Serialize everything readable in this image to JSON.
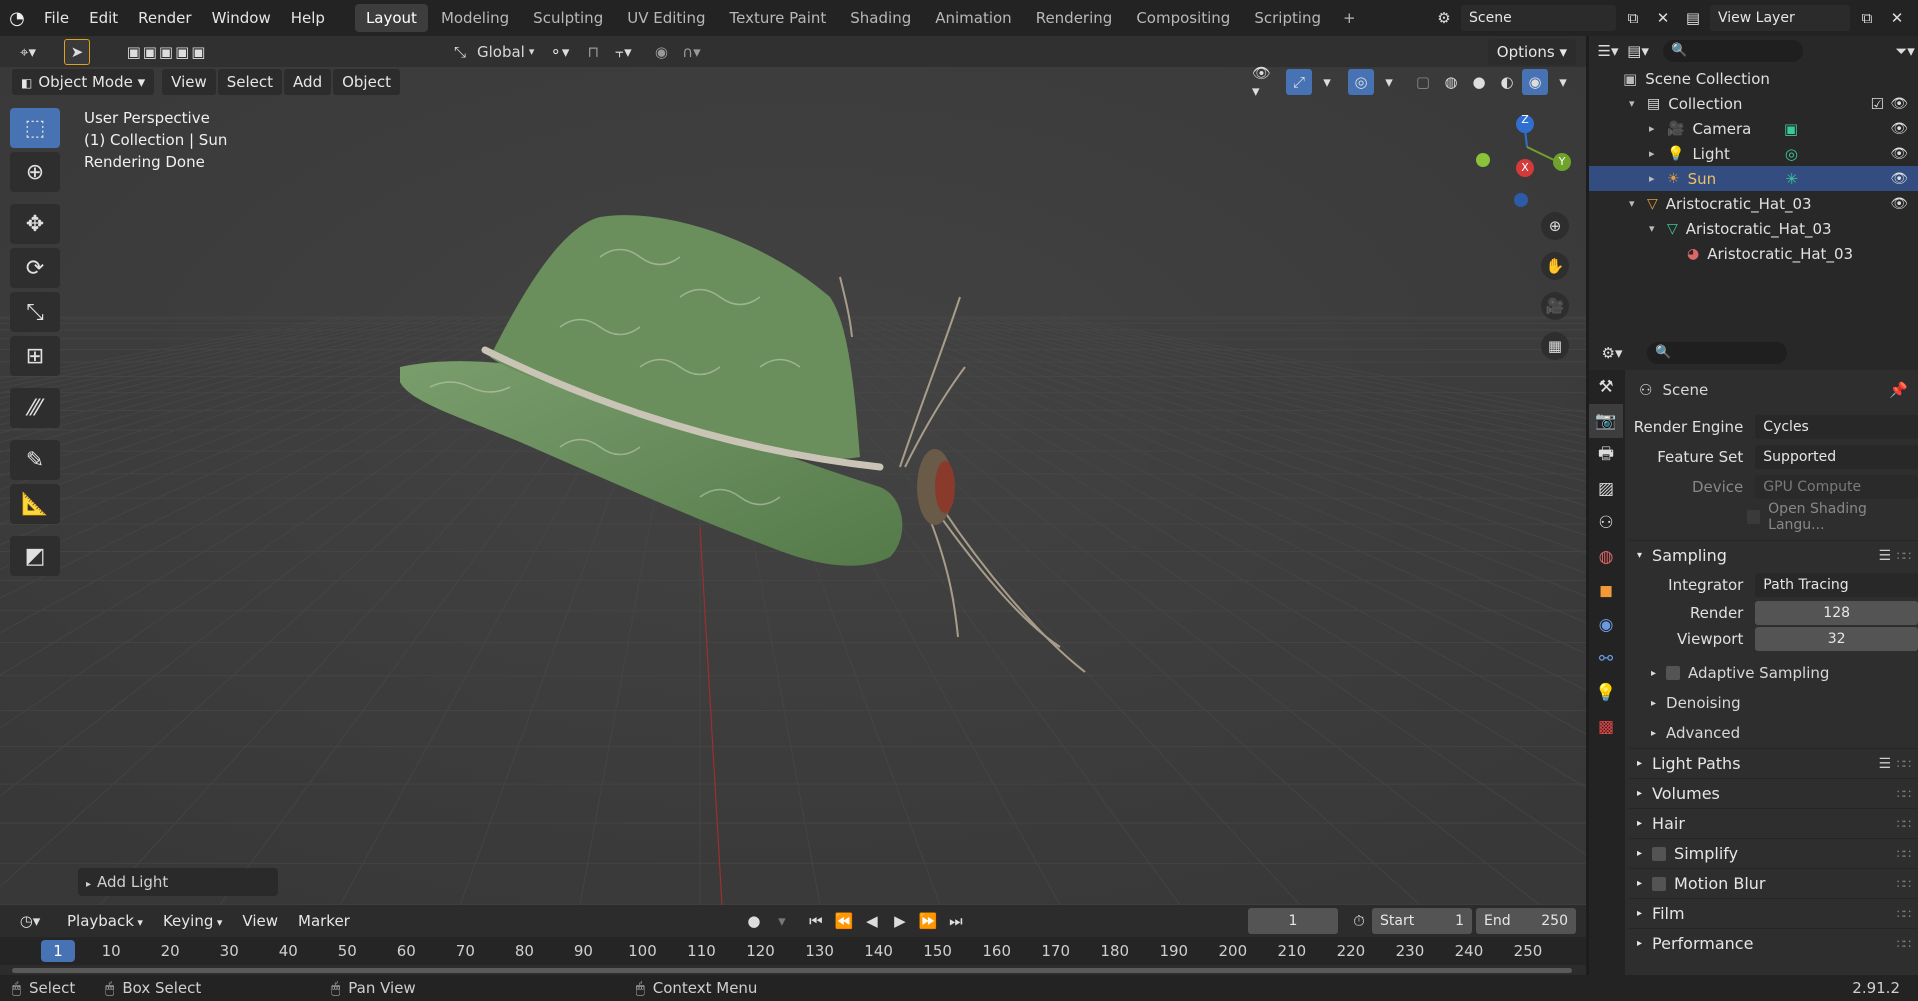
{
  "topbar": {
    "menus": [
      "File",
      "Edit",
      "Render",
      "Window",
      "Help"
    ],
    "workspaces": [
      "Layout",
      "Modeling",
      "Sculpting",
      "UV Editing",
      "Texture Paint",
      "Shading",
      "Animation",
      "Rendering",
      "Compositing",
      "Scripting"
    ],
    "active_workspace": "Layout",
    "add_workspace": "+",
    "scene": "Scene",
    "view_layer": "View Layer"
  },
  "tool_header": {
    "orientation": "Global",
    "options": "Options"
  },
  "viewport_header": {
    "mode": "Object Mode",
    "menus": [
      "View",
      "Select",
      "Add",
      "Object"
    ]
  },
  "viewport": {
    "info_lines": [
      "User Perspective",
      "(1) Collection | Sun",
      "Rendering Done"
    ],
    "gizmo": {
      "z": "Z",
      "x": "X",
      "y": "Y"
    },
    "last_operator": "Add Light"
  },
  "outliner": {
    "root": "Scene Collection",
    "items": [
      {
        "label": "Collection",
        "icon": "collection-icon",
        "depth": 1,
        "expand": "▾",
        "selected": false
      },
      {
        "label": "Camera",
        "icon": "camera-icon",
        "depth": 2,
        "expand": "▸",
        "selected": false
      },
      {
        "label": "Light",
        "icon": "light-icon",
        "depth": 2,
        "expand": "▸",
        "selected": false
      },
      {
        "label": "Sun",
        "icon": "sun-light-icon",
        "depth": 2,
        "expand": "▸",
        "selected": true
      },
      {
        "label": "Aristocratic_Hat_03",
        "icon": "mesh-object-icon",
        "depth": 1,
        "expand": "▾",
        "selected": false
      },
      {
        "label": "Aristocratic_Hat_03",
        "icon": "mesh-data-icon",
        "depth": 2,
        "expand": "▾",
        "selected": false
      },
      {
        "label": "Aristocratic_Hat_03",
        "icon": "material-icon",
        "depth": 3,
        "expand": "",
        "selected": false
      }
    ]
  },
  "properties": {
    "context": "Scene",
    "rows": [
      {
        "label": "Render Engine",
        "value": "Cycles"
      },
      {
        "label": "Feature Set",
        "value": "Supported"
      },
      {
        "label": "Device",
        "value": "GPU Compute"
      }
    ],
    "osl": "Open Shading Langu...",
    "sampling": {
      "title": "Sampling",
      "integrator_label": "Integrator",
      "integrator": "Path Tracing",
      "render_label": "Render",
      "render": "128",
      "viewport_label": "Viewport",
      "viewport": "32",
      "subsections": [
        "Adaptive Sampling",
        "Denoising",
        "Advanced"
      ]
    },
    "sections": [
      "Light Paths",
      "Volumes",
      "Hair",
      "Simplify",
      "Motion Blur",
      "Film",
      "Performance"
    ]
  },
  "timeline": {
    "menus": [
      "Playback",
      "Keying",
      "View",
      "Marker"
    ],
    "current_frame": "1",
    "start_label": "Start",
    "start": "1",
    "end_label": "End",
    "end": "250",
    "ruler": [
      "1",
      "10",
      "20",
      "30",
      "40",
      "50",
      "60",
      "70",
      "80",
      "90",
      "100",
      "110",
      "120",
      "130",
      "140",
      "150",
      "160",
      "170",
      "180",
      "190",
      "200",
      "210",
      "220",
      "230",
      "240",
      "250"
    ]
  },
  "statusbar": {
    "select": "Select",
    "box_select": "Box Select",
    "pan_view": "Pan View",
    "context_menu": "Context Menu",
    "version": "2.91.2"
  },
  "colors": {
    "accent": "#4772b3",
    "selected_row": "#334d80",
    "hat": "#6b8f5e",
    "viewport_bg": "#3d3d3d"
  }
}
